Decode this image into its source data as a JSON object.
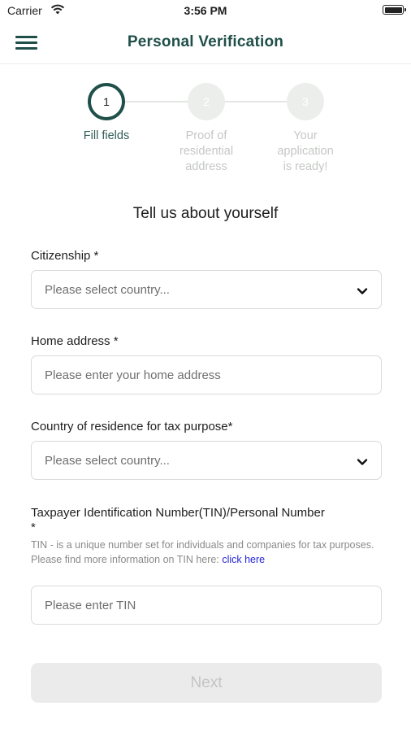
{
  "status": {
    "carrier": "Carrier",
    "time": "3:56 PM"
  },
  "nav": {
    "title": "Personal Verification"
  },
  "stepper": {
    "steps": [
      {
        "number": "1",
        "line1": "Fill fields",
        "line2": "",
        "line3": ""
      },
      {
        "number": "2",
        "line1": "Proof of",
        "line2": "residential",
        "line3": "address"
      },
      {
        "number": "3",
        "line1": "Your",
        "line2": "application",
        "line3": "is ready!"
      }
    ]
  },
  "form": {
    "heading": "Tell us about yourself",
    "citizenship": {
      "label": "Citizenship *",
      "placeholder": "Please select country..."
    },
    "home_address": {
      "label": "Home address *",
      "placeholder": "Please enter your home address"
    },
    "tax_country": {
      "label": "Country of residence for tax purpose*",
      "placeholder": "Please select country..."
    },
    "tin": {
      "label_line1": "Taxpayer Identification Number(TIN)/Personal Number",
      "label_line2": "*",
      "hint": "TIN - is a unique number set for individuals and companies for tax purposes. Please find more information on TIN here: ",
      "link": "click here",
      "placeholder": "Please enter TIN"
    },
    "next_label": "Next"
  },
  "colors": {
    "accent": "#1f4f49",
    "link": "#2424d6",
    "disabled_button": "#ebebeb"
  },
  "icons": {
    "menu": "hamburger-menu-icon",
    "dropdown": "chevron-down-icon",
    "wifi": "wifi-icon",
    "battery": "battery-icon"
  }
}
